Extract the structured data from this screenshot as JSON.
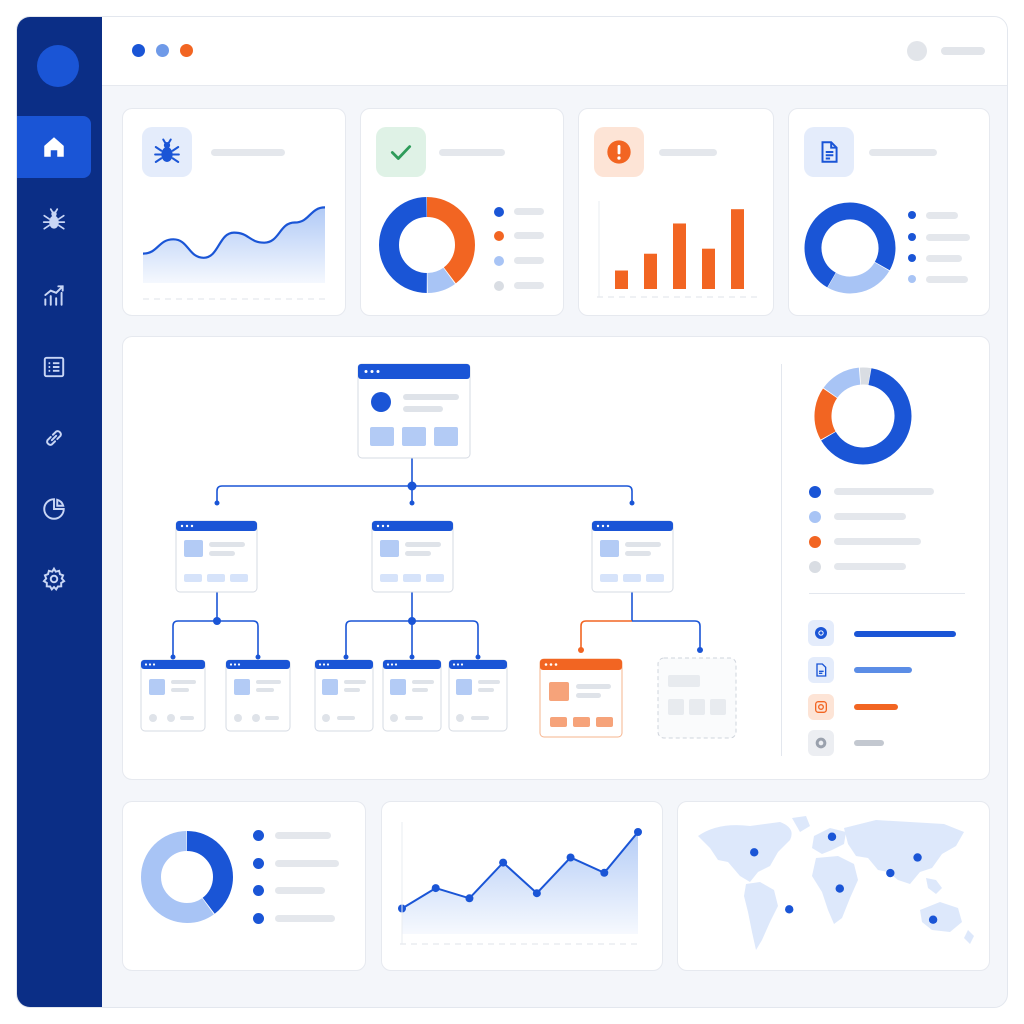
{
  "sidebar": {
    "items": [
      {
        "icon": "home-icon",
        "active": true
      },
      {
        "icon": "bug-icon",
        "active": false
      },
      {
        "icon": "analytics-icon",
        "active": false
      },
      {
        "icon": "list-icon",
        "active": false
      },
      {
        "icon": "link-icon",
        "active": false
      },
      {
        "icon": "pie-chart-icon",
        "active": false
      },
      {
        "icon": "gear-icon",
        "active": false
      }
    ]
  },
  "header": {
    "window_dots": [
      "#1a55d6",
      "#6f9ae8",
      "#f26522"
    ]
  },
  "colors": {
    "primary": "#1a55d6",
    "light_blue": "#a8c4f5",
    "orange": "#f26522",
    "green": "#2e9c5a",
    "sidebar": "#0b2e86",
    "gray": "#d9dde3"
  },
  "stat_cards": [
    {
      "icon": "bug-icon"
    },
    {
      "icon": "check-icon"
    },
    {
      "icon": "alert-icon"
    },
    {
      "icon": "document-icon"
    }
  ],
  "site_tree": {
    "root": "page",
    "levels": 3,
    "error_node_color": "#f26522",
    "placeholder_node": true
  },
  "link_legend": [
    {
      "icon": "chrome-icon"
    },
    {
      "icon": "file-icon"
    },
    {
      "icon": "image-icon"
    },
    {
      "icon": "settings-icon"
    }
  ],
  "chart_data": [
    {
      "type": "area",
      "y": [
        0.35,
        0.52,
        0.3,
        0.6,
        0.48,
        0.72,
        0.9
      ],
      "ylim": [
        0,
        1
      ]
    },
    {
      "type": "pie",
      "series": [
        {
          "values": [
            40,
            10,
            50
          ],
          "colors": [
            "#f26522",
            "#a8c4f5",
            "#1a55d6"
          ]
        }
      ]
    },
    {
      "type": "bar",
      "values": [
        0.22,
        0.42,
        0.78,
        0.48,
        0.95
      ],
      "ylim": [
        0,
        1
      ]
    },
    {
      "type": "pie",
      "series": [
        {
          "values": [
            75,
            25
          ],
          "colors": [
            "#1a55d6",
            "#a8c4f5"
          ]
        }
      ]
    },
    {
      "type": "pie",
      "series": [
        {
          "values": [
            64,
            18,
            14,
            4
          ],
          "colors": [
            "#1a55d6",
            "#f26522",
            "#a8c4f5",
            "#d9dde3"
          ]
        }
      ]
    },
    {
      "type": "pie",
      "series": [
        {
          "values": [
            40,
            60
          ],
          "colors": [
            "#1a55d6",
            "#a8c4f5"
          ]
        }
      ]
    },
    {
      "type": "line",
      "y": [
        0.25,
        0.45,
        0.35,
        0.7,
        0.4,
        0.75,
        0.6,
        1.0
      ],
      "ylim": [
        0,
        1
      ]
    },
    {
      "type": "map",
      "points": [
        {
          "lon": -100,
          "lat": 40
        },
        {
          "lon": -55,
          "lat": -15
        },
        {
          "lon": 0,
          "lat": 55
        },
        {
          "lon": 10,
          "lat": 5
        },
        {
          "lon": 75,
          "lat": 20
        },
        {
          "lon": 110,
          "lat": 35
        },
        {
          "lon": 130,
          "lat": -25
        }
      ]
    }
  ]
}
